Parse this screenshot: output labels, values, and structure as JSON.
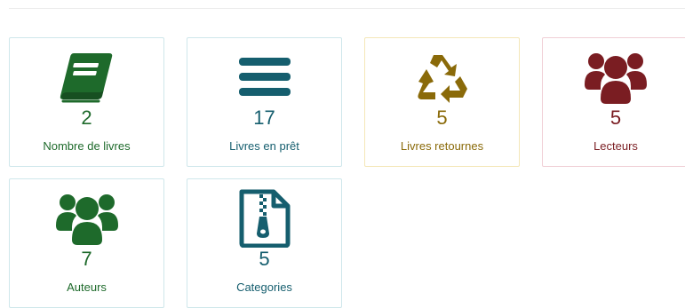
{
  "stats": [
    {
      "count": "2",
      "label": "Nombre de livres",
      "icon": "book-icon",
      "color": "#1e6a2b"
    },
    {
      "count": "17",
      "label": "Livres en prêt",
      "icon": "bars-icon",
      "color": "#155e6e"
    },
    {
      "count": "5",
      "label": "Livres retournes",
      "icon": "recycle-icon",
      "color": "#8a6a09"
    },
    {
      "count": "5",
      "label": "Lecteurs",
      "icon": "users-icon",
      "color": "#7a1d22"
    },
    {
      "count": "7",
      "label": "Auteurs",
      "icon": "users-icon",
      "color": "#1e6a2b"
    },
    {
      "count": "5",
      "label": "Categories",
      "icon": "file-zip-icon",
      "color": "#155e6e"
    }
  ]
}
